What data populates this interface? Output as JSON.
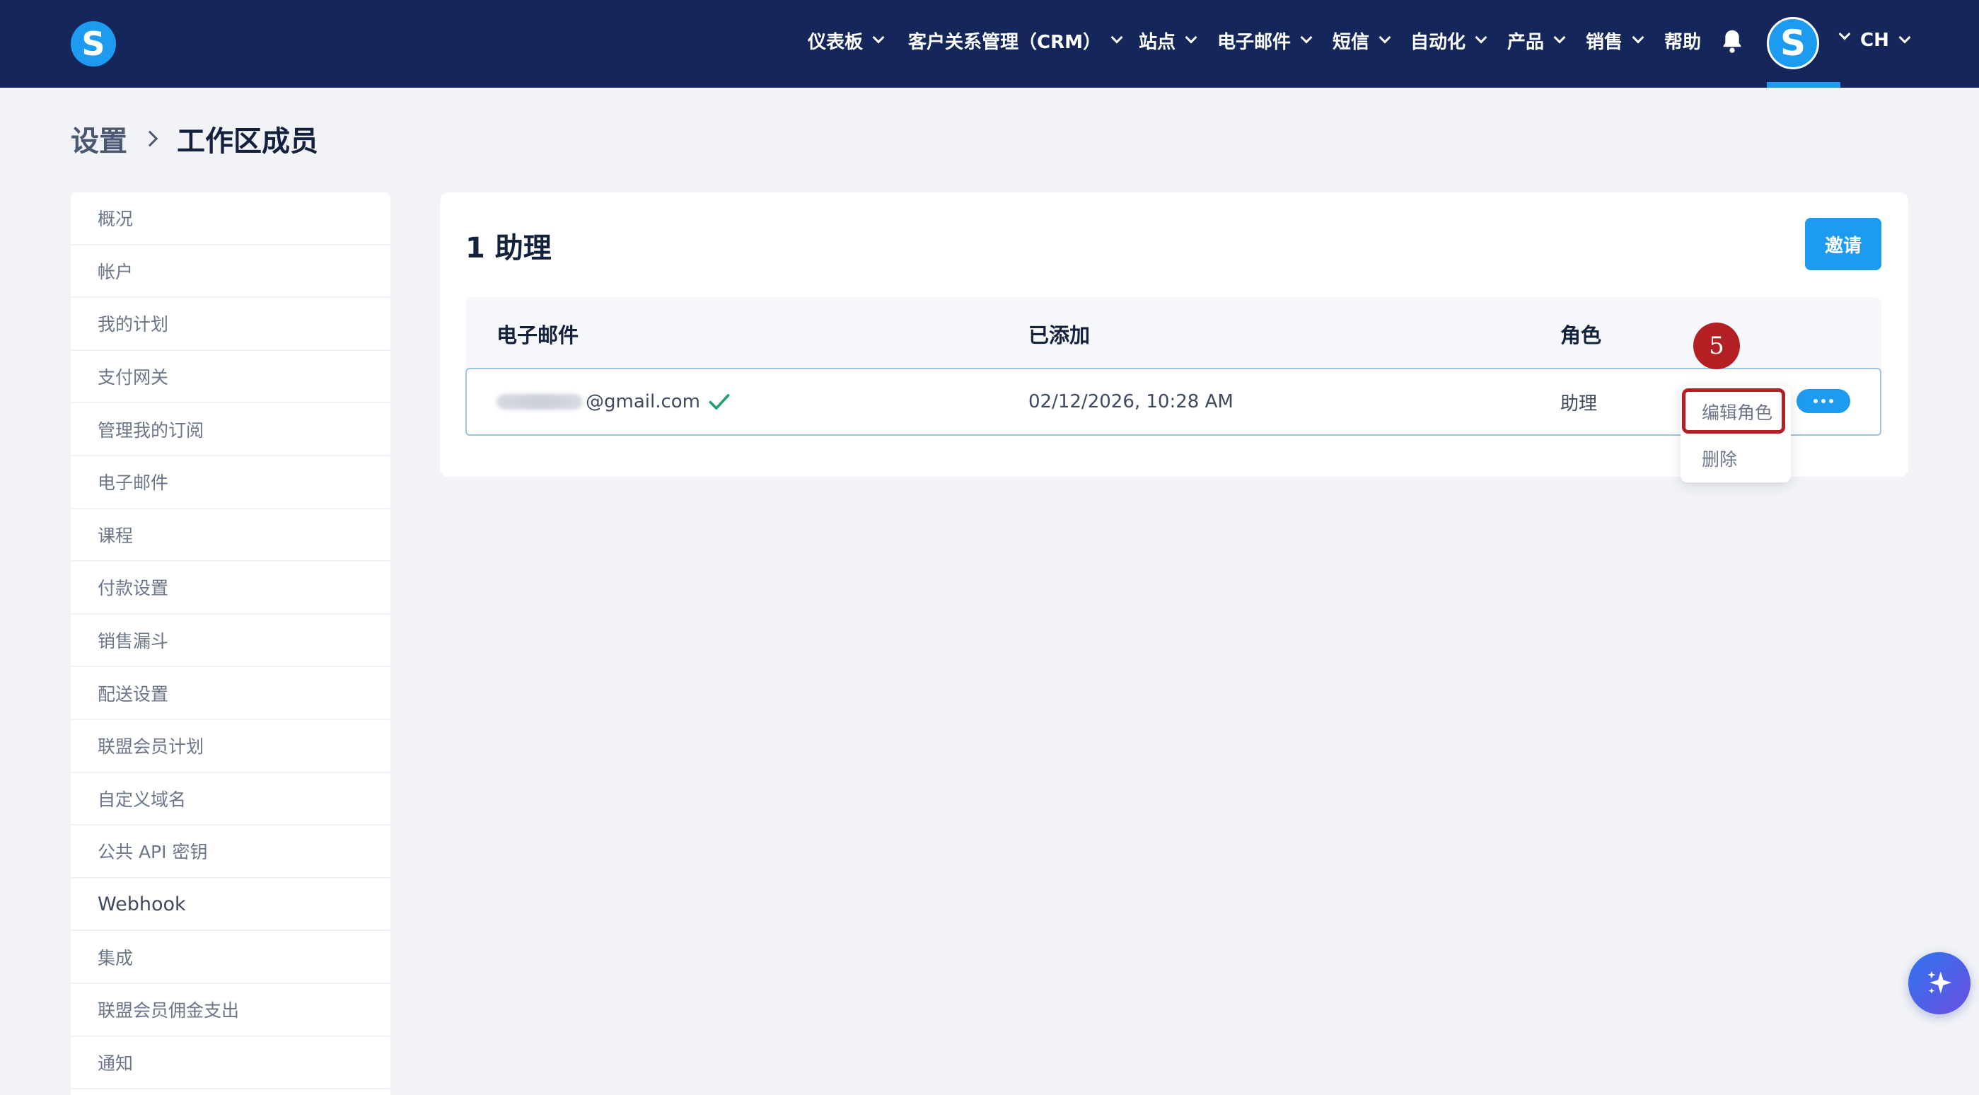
{
  "app": {
    "logo_letter": "S"
  },
  "nav": {
    "items": [
      {
        "label": "仪表板"
      },
      {
        "label": "客户关系管理（CRM）"
      },
      {
        "label": "站点"
      },
      {
        "label": "电子邮件"
      },
      {
        "label": "短信"
      },
      {
        "label": "自动化"
      },
      {
        "label": "产品"
      },
      {
        "label": "销售"
      }
    ],
    "help": "帮助",
    "avatar_letter": "S",
    "language": "CH"
  },
  "breadcrumb": {
    "parent": "设置",
    "current": "工作区成员"
  },
  "sidebar": {
    "items": [
      {
        "label": "概况"
      },
      {
        "label": "帐户"
      },
      {
        "label": "我的计划"
      },
      {
        "label": "支付网关"
      },
      {
        "label": "管理我的订阅"
      },
      {
        "label": "电子邮件"
      },
      {
        "label": "课程"
      },
      {
        "label": "付款设置"
      },
      {
        "label": "销售漏斗"
      },
      {
        "label": "配送设置"
      },
      {
        "label": "联盟会员计划"
      },
      {
        "label": "自定义域名"
      },
      {
        "label": "公共 API 密钥"
      },
      {
        "label": "Webhook"
      },
      {
        "label": "集成"
      },
      {
        "label": "联盟会员佣金支出"
      },
      {
        "label": "通知"
      }
    ]
  },
  "members": {
    "title": "1 助理",
    "invite_label": "邀请",
    "columns": {
      "email": "电子邮件",
      "added": "已添加",
      "role": "角色"
    },
    "rows": [
      {
        "email_domain": "@gmail.com",
        "added": "02/12/2026, 10:28 AM",
        "role": "助理"
      }
    ]
  },
  "row_menu": {
    "edit_role": "编辑角色",
    "delete": "删除"
  },
  "annotation": {
    "step": "5",
    "color": "#b31f23"
  },
  "colors": {
    "nav_bg": "#15275a",
    "accent": "#1c9bf0",
    "page_bg": "#f1f3f7"
  }
}
